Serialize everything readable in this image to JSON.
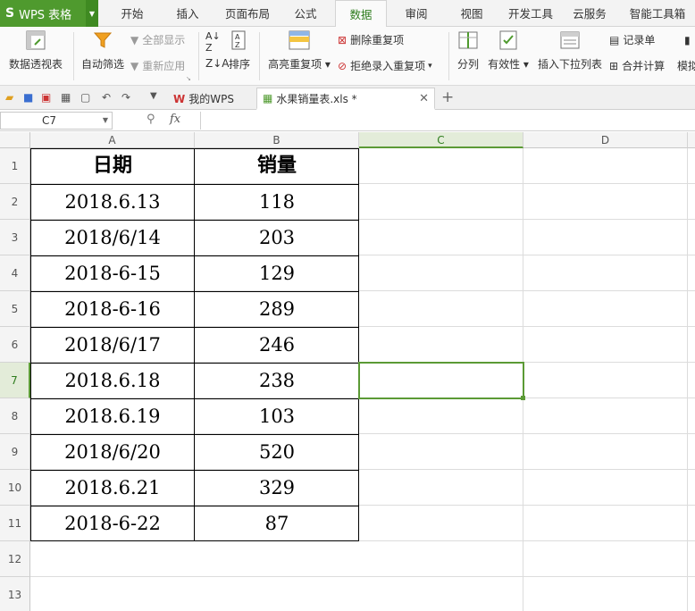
{
  "app": {
    "name": "WPS 表格"
  },
  "menu_tabs": [
    "开始",
    "插入",
    "页面布局",
    "公式",
    "数据",
    "审阅",
    "视图",
    "开发工具",
    "云服务",
    "智能工具箱"
  ],
  "active_tab": "数据",
  "ribbon": {
    "pivot": "数据透视表",
    "autofilter": "自动筛选",
    "show_all": "全部显示",
    "reapply": "重新应用",
    "sort": "排序",
    "highlight_dup": "高亮重复项",
    "remove_dup": "删除重复项",
    "reject_dup": "拒绝录入重复项",
    "split": "分列",
    "validity": "有效性",
    "insert_dropdown": "插入下拉列表",
    "record_form": "记录单",
    "consolidate": "合并计算",
    "simulate": "模拟"
  },
  "doc_tabs": {
    "home": "我的WPS",
    "file": "水果销量表.xls *"
  },
  "name_box": "C7",
  "fx": "fx",
  "columns": [
    "A",
    "B",
    "C",
    "D"
  ],
  "rows": [
    "1",
    "2",
    "3",
    "4",
    "5",
    "6",
    "7",
    "8",
    "9",
    "10",
    "11",
    "12",
    "13"
  ],
  "table": {
    "header": {
      "date": "日期",
      "qty": "销量"
    },
    "rows": [
      {
        "date": "2018.6.13",
        "qty": "118"
      },
      {
        "date": "2018/6/14",
        "qty": "203"
      },
      {
        "date": "2018-6-15",
        "qty": "129"
      },
      {
        "date": "2018-6-16",
        "qty": "289"
      },
      {
        "date": "2018/6/17",
        "qty": "246"
      },
      {
        "date": "2018.6.18",
        "qty": "238"
      },
      {
        "date": "2018.6.19",
        "qty": "103"
      },
      {
        "date": "2018/6/20",
        "qty": "520"
      },
      {
        "date": "2018.6.21",
        "qty": "329"
      },
      {
        "date": "2018-6-22",
        "qty": "87"
      }
    ]
  },
  "colors": {
    "accent": "#4f9a2e",
    "selection": "#5b9a35"
  }
}
